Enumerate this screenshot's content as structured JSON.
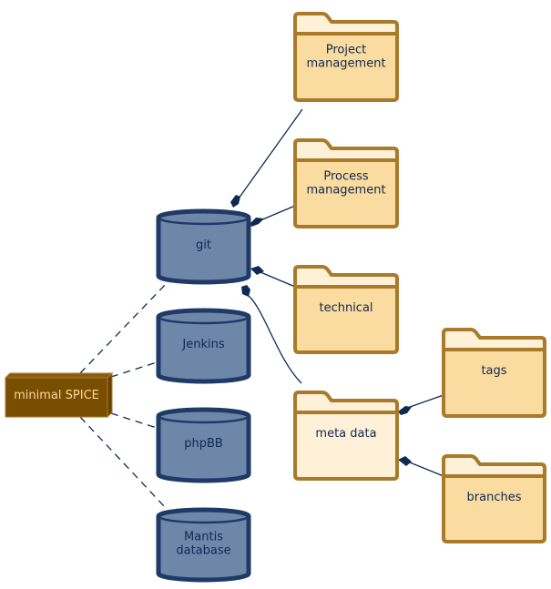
{
  "node": {
    "label": "minimal SPICE"
  },
  "databases": [
    {
      "label": [
        "git"
      ]
    },
    {
      "label": [
        "Jenkins"
      ]
    },
    {
      "label": [
        "phpBB"
      ]
    },
    {
      "label": [
        "Mantis",
        "database"
      ]
    }
  ],
  "folders": [
    {
      "label": [
        "Project",
        "management"
      ]
    },
    {
      "label": [
        "Process",
        "management"
      ]
    },
    {
      "label": [
        "technical"
      ]
    },
    {
      "label": [
        "meta data"
      ]
    },
    {
      "label": [
        "tags"
      ]
    },
    {
      "label": [
        "branches"
      ]
    }
  ],
  "colors": {
    "folder_fill": "#fadba0",
    "folder_tab_fill": "#fff0d8",
    "folder_highlight_fill": "#fff0d8",
    "folder_stroke": "#a87a2a",
    "database_fill": "#6e86a8",
    "database_stroke": "#1e3a66",
    "node_fill": "#7a4e00",
    "node_text": "#f5d9a0",
    "edge": "#0f2a52"
  }
}
